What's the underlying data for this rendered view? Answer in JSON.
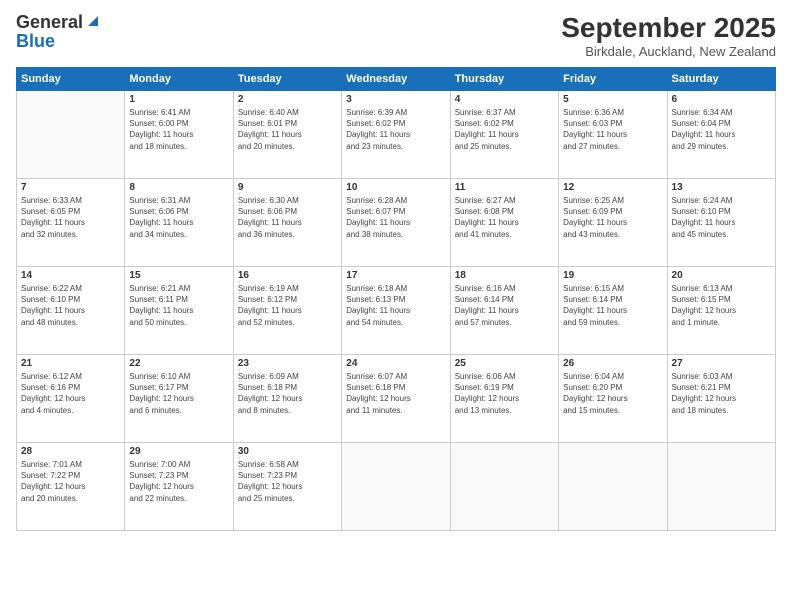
{
  "header": {
    "logo_general": "General",
    "logo_blue": "Blue",
    "month_title": "September 2025",
    "location": "Birkdale, Auckland, New Zealand"
  },
  "days_of_week": [
    "Sunday",
    "Monday",
    "Tuesday",
    "Wednesday",
    "Thursday",
    "Friday",
    "Saturday"
  ],
  "weeks": [
    [
      {
        "day": "",
        "info": ""
      },
      {
        "day": "1",
        "info": "Sunrise: 6:41 AM\nSunset: 6:00 PM\nDaylight: 11 hours\nand 18 minutes."
      },
      {
        "day": "2",
        "info": "Sunrise: 6:40 AM\nSunset: 6:01 PM\nDaylight: 11 hours\nand 20 minutes."
      },
      {
        "day": "3",
        "info": "Sunrise: 6:39 AM\nSunset: 6:02 PM\nDaylight: 11 hours\nand 23 minutes."
      },
      {
        "day": "4",
        "info": "Sunrise: 6:37 AM\nSunset: 6:02 PM\nDaylight: 11 hours\nand 25 minutes."
      },
      {
        "day": "5",
        "info": "Sunrise: 6:36 AM\nSunset: 6:03 PM\nDaylight: 11 hours\nand 27 minutes."
      },
      {
        "day": "6",
        "info": "Sunrise: 6:34 AM\nSunset: 6:04 PM\nDaylight: 11 hours\nand 29 minutes."
      }
    ],
    [
      {
        "day": "7",
        "info": "Sunrise: 6:33 AM\nSunset: 6:05 PM\nDaylight: 11 hours\nand 32 minutes."
      },
      {
        "day": "8",
        "info": "Sunrise: 6:31 AM\nSunset: 6:06 PM\nDaylight: 11 hours\nand 34 minutes."
      },
      {
        "day": "9",
        "info": "Sunrise: 6:30 AM\nSunset: 6:06 PM\nDaylight: 11 hours\nand 36 minutes."
      },
      {
        "day": "10",
        "info": "Sunrise: 6:28 AM\nSunset: 6:07 PM\nDaylight: 11 hours\nand 38 minutes."
      },
      {
        "day": "11",
        "info": "Sunrise: 6:27 AM\nSunset: 6:08 PM\nDaylight: 11 hours\nand 41 minutes."
      },
      {
        "day": "12",
        "info": "Sunrise: 6:25 AM\nSunset: 6:09 PM\nDaylight: 11 hours\nand 43 minutes."
      },
      {
        "day": "13",
        "info": "Sunrise: 6:24 AM\nSunset: 6:10 PM\nDaylight: 11 hours\nand 45 minutes."
      }
    ],
    [
      {
        "day": "14",
        "info": "Sunrise: 6:22 AM\nSunset: 6:10 PM\nDaylight: 11 hours\nand 48 minutes."
      },
      {
        "day": "15",
        "info": "Sunrise: 6:21 AM\nSunset: 6:11 PM\nDaylight: 11 hours\nand 50 minutes."
      },
      {
        "day": "16",
        "info": "Sunrise: 6:19 AM\nSunset: 6:12 PM\nDaylight: 11 hours\nand 52 minutes."
      },
      {
        "day": "17",
        "info": "Sunrise: 6:18 AM\nSunset: 6:13 PM\nDaylight: 11 hours\nand 54 minutes."
      },
      {
        "day": "18",
        "info": "Sunrise: 6:16 AM\nSunset: 6:14 PM\nDaylight: 11 hours\nand 57 minutes."
      },
      {
        "day": "19",
        "info": "Sunrise: 6:15 AM\nSunset: 6:14 PM\nDaylight: 11 hours\nand 59 minutes."
      },
      {
        "day": "20",
        "info": "Sunrise: 6:13 AM\nSunset: 6:15 PM\nDaylight: 12 hours\nand 1 minute."
      }
    ],
    [
      {
        "day": "21",
        "info": "Sunrise: 6:12 AM\nSunset: 6:16 PM\nDaylight: 12 hours\nand 4 minutes."
      },
      {
        "day": "22",
        "info": "Sunrise: 6:10 AM\nSunset: 6:17 PM\nDaylight: 12 hours\nand 6 minutes."
      },
      {
        "day": "23",
        "info": "Sunrise: 6:09 AM\nSunset: 6:18 PM\nDaylight: 12 hours\nand 8 minutes."
      },
      {
        "day": "24",
        "info": "Sunrise: 6:07 AM\nSunset: 6:18 PM\nDaylight: 12 hours\nand 11 minutes."
      },
      {
        "day": "25",
        "info": "Sunrise: 6:06 AM\nSunset: 6:19 PM\nDaylight: 12 hours\nand 13 minutes."
      },
      {
        "day": "26",
        "info": "Sunrise: 6:04 AM\nSunset: 6:20 PM\nDaylight: 12 hours\nand 15 minutes."
      },
      {
        "day": "27",
        "info": "Sunrise: 6:03 AM\nSunset: 6:21 PM\nDaylight: 12 hours\nand 18 minutes."
      }
    ],
    [
      {
        "day": "28",
        "info": "Sunrise: 7:01 AM\nSunset: 7:22 PM\nDaylight: 12 hours\nand 20 minutes."
      },
      {
        "day": "29",
        "info": "Sunrise: 7:00 AM\nSunset: 7:23 PM\nDaylight: 12 hours\nand 22 minutes."
      },
      {
        "day": "30",
        "info": "Sunrise: 6:58 AM\nSunset: 7:23 PM\nDaylight: 12 hours\nand 25 minutes."
      },
      {
        "day": "",
        "info": ""
      },
      {
        "day": "",
        "info": ""
      },
      {
        "day": "",
        "info": ""
      },
      {
        "day": "",
        "info": ""
      }
    ]
  ]
}
